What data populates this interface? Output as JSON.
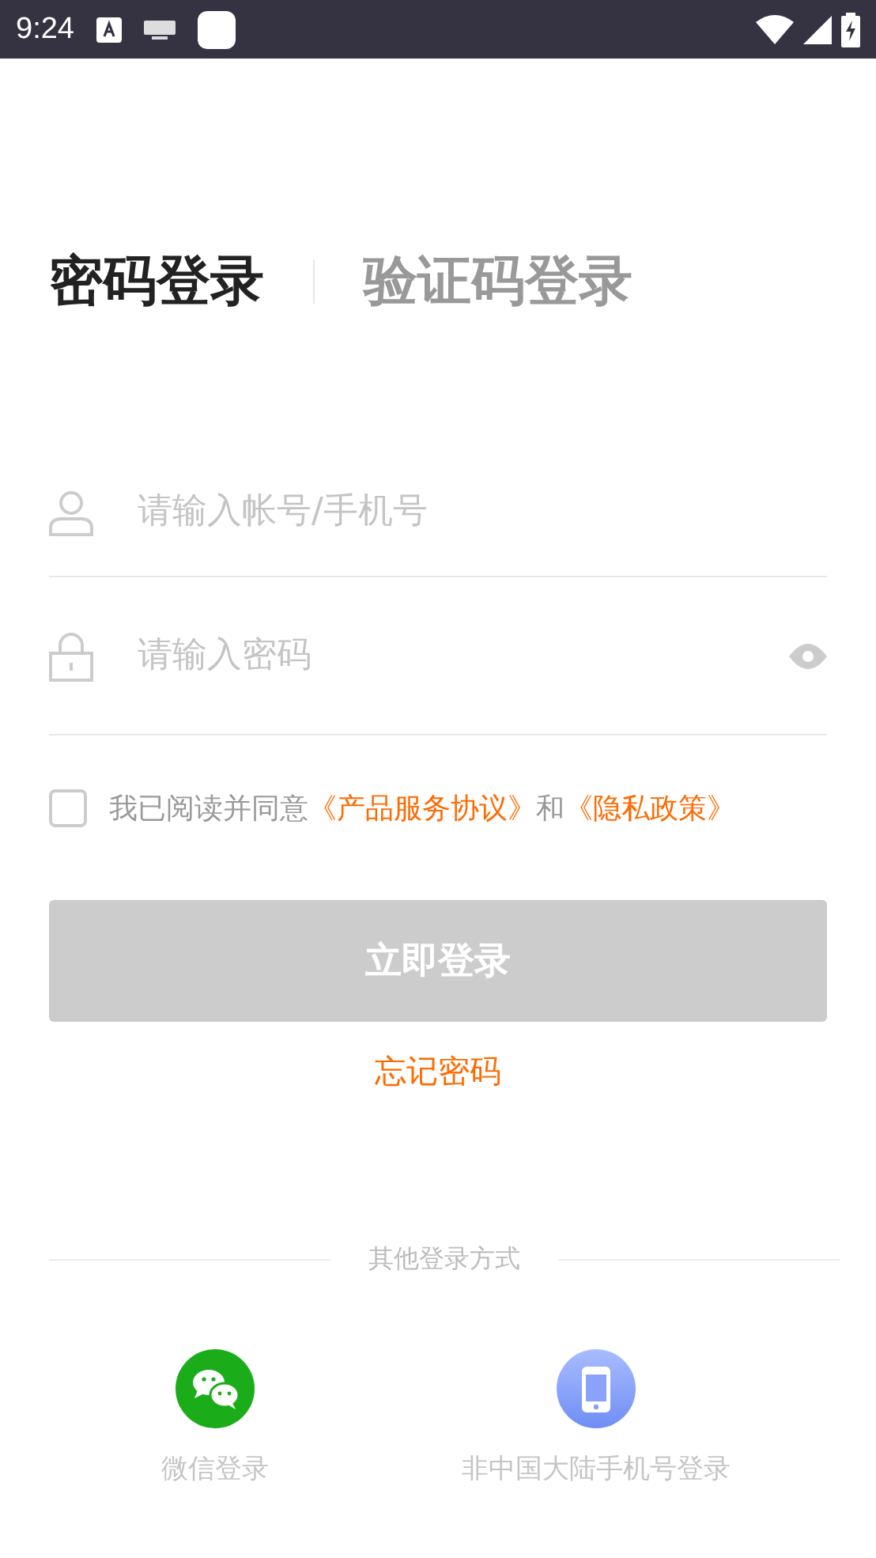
{
  "status_bar": {
    "time": "9:24"
  },
  "tabs": [
    {
      "label": "密码登录",
      "selected": true
    },
    {
      "label": "验证码登录",
      "selected": false
    }
  ],
  "fields": [
    {
      "kind": "account",
      "placeholder": "请输入帐号/手机号"
    },
    {
      "kind": "password",
      "placeholder": "请输入密码"
    }
  ],
  "agreement": {
    "checked": false,
    "parts": [
      {
        "kind": "text",
        "text": "我已阅读并同意"
      },
      {
        "kind": "link",
        "text": "《产品服务协议》"
      },
      {
        "kind": "text",
        "text": "和"
      },
      {
        "kind": "link",
        "text": "《隐私政策》"
      }
    ]
  },
  "login_button": {
    "label": "立即登录",
    "disabled": true
  },
  "forgot_link": "忘记密码",
  "other_methods": {
    "title": "其他登录方式",
    "items": [
      {
        "kind": "wechat",
        "label": "微信登录"
      },
      {
        "kind": "phone",
        "label": "非中国大陆手机号登录"
      }
    ]
  }
}
